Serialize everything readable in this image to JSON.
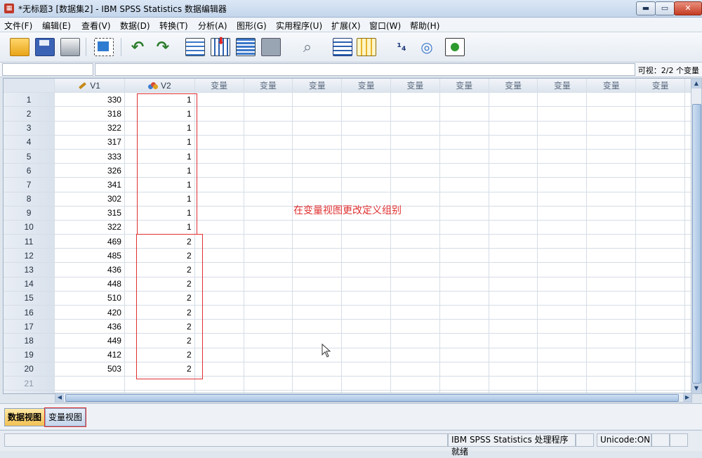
{
  "window": {
    "title": "*无标题3 [数据集2] - IBM SPSS Statistics 数据编辑器",
    "app_icon": "spss-app-icon",
    "minimize_label": "▬",
    "maximize_label": "▭",
    "close_label": "✕"
  },
  "menu": {
    "items": [
      {
        "label": "文件(F)"
      },
      {
        "label": "编辑(E)"
      },
      {
        "label": "查看(V)"
      },
      {
        "label": "数据(D)"
      },
      {
        "label": "转换(T)"
      },
      {
        "label": "分析(A)"
      },
      {
        "label": "图形(G)"
      },
      {
        "label": "实用程序(U)"
      },
      {
        "label": "扩展(X)"
      },
      {
        "label": "窗口(W)"
      },
      {
        "label": "帮助(H)"
      }
    ]
  },
  "toolbar": {
    "icons": [
      "open-folder-icon",
      "save-icon",
      "print-icon",
      "recall-dialog-icon",
      "undo-icon",
      "redo-icon",
      "goto-case-icon",
      "goto-variable-icon",
      "variables-icon",
      "run-descriptives-icon",
      "find-icon",
      "insert-cases-icon",
      "insert-variable-icon",
      "split-file-icon",
      "weight-cases-icon",
      "select-cases-icon",
      "value-labels-icon"
    ]
  },
  "cellbar": {
    "visible_label": "可视：2/2 个变量"
  },
  "grid": {
    "columns": [
      "V1",
      "V2",
      "变量",
      "变量",
      "变量",
      "变量",
      "变量",
      "变量",
      "变量",
      "变量",
      "变量",
      "变量"
    ],
    "v1_icon": "scale-ruler-icon",
    "v2_icon": "nominal-icon",
    "rows": [
      {
        "n": "1",
        "v1": "330",
        "v2": "1"
      },
      {
        "n": "2",
        "v1": "318",
        "v2": "1"
      },
      {
        "n": "3",
        "v1": "322",
        "v2": "1"
      },
      {
        "n": "4",
        "v1": "317",
        "v2": "1"
      },
      {
        "n": "5",
        "v1": "333",
        "v2": "1"
      },
      {
        "n": "6",
        "v1": "326",
        "v2": "1"
      },
      {
        "n": "7",
        "v1": "341",
        "v2": "1"
      },
      {
        "n": "8",
        "v1": "302",
        "v2": "1"
      },
      {
        "n": "9",
        "v1": "315",
        "v2": "1"
      },
      {
        "n": "10",
        "v1": "322",
        "v2": "1"
      },
      {
        "n": "11",
        "v1": "469",
        "v2": "2"
      },
      {
        "n": "12",
        "v1": "485",
        "v2": "2"
      },
      {
        "n": "13",
        "v1": "436",
        "v2": "2"
      },
      {
        "n": "14",
        "v1": "448",
        "v2": "2"
      },
      {
        "n": "15",
        "v1": "510",
        "v2": "2"
      },
      {
        "n": "16",
        "v1": "420",
        "v2": "2"
      },
      {
        "n": "17",
        "v1": "436",
        "v2": "2"
      },
      {
        "n": "18",
        "v1": "449",
        "v2": "2"
      },
      {
        "n": "19",
        "v1": "412",
        "v2": "2"
      },
      {
        "n": "20",
        "v1": "503",
        "v2": "2"
      },
      {
        "n": "21",
        "v1": "",
        "v2": ""
      }
    ]
  },
  "annotation": {
    "text": "在变量视图更改定义组别",
    "color": "#e03030"
  },
  "tabs": {
    "data_view": "数据视图",
    "variable_view": "变量视图"
  },
  "status": {
    "processor": "IBM SPSS Statistics 处理程序就绪",
    "unicode": "Unicode:ON"
  }
}
